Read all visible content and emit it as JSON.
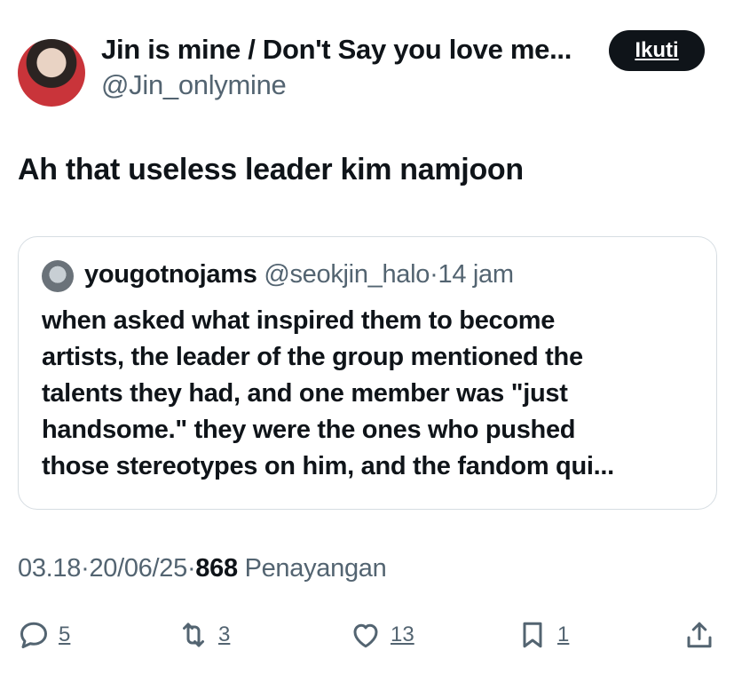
{
  "author": {
    "display_name": "Jin is mine / Don't Say you love me...",
    "handle": "@Jin_onlymine",
    "avatar_icon": "profile-photo"
  },
  "follow_button": {
    "label": "Ikuti"
  },
  "tweet": {
    "text": "Ah that useless leader kim namjoon"
  },
  "quoted_tweet": {
    "author_name": "yougotnojams",
    "author_handle": "@seokjin_halo",
    "separator": "·",
    "time": "14 jam",
    "text_lines": [
      "when asked what inspired them to become",
      "artists, the leader of the group mentioned the",
      "talents they had, and one member was \"just",
      "handsome.\" they were the ones who pushed",
      "those stereotypes on him, and the fandom qui..."
    ]
  },
  "meta": {
    "time": "03.18",
    "separator": "·",
    "date": "20/06/25",
    "views_count": "868",
    "views_label": "Penayangan"
  },
  "actions": {
    "replies": "5",
    "reposts": "3",
    "likes": "13",
    "bookmarks": "1"
  },
  "colors": {
    "text": "#0f1419",
    "secondary": "#536471",
    "border": "#d6dde2",
    "button_bg": "#0f1419"
  }
}
